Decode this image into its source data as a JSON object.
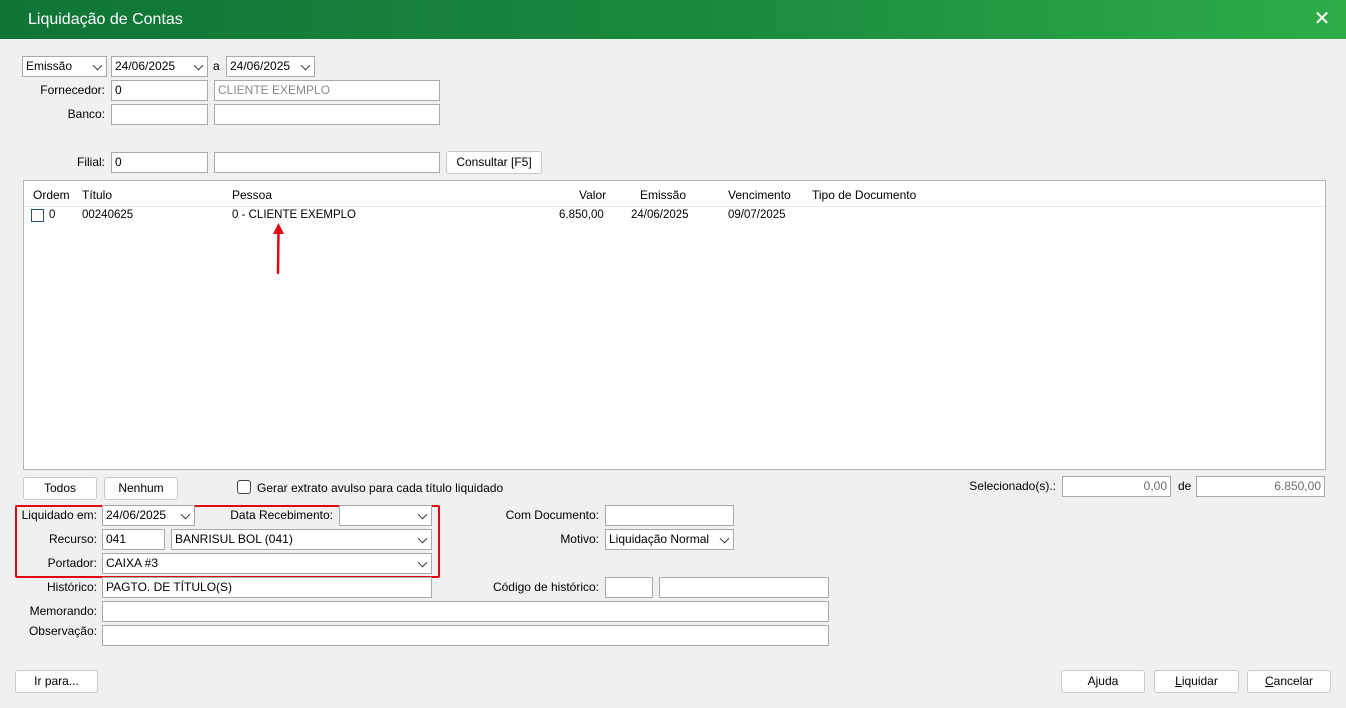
{
  "window": {
    "title": "Liquidação de Contas"
  },
  "filters": {
    "date_type": "Emissão",
    "date_from": "24/06/2025",
    "separator": "a",
    "date_to": "24/06/2025",
    "fornecedor_label": "Fornecedor:",
    "fornecedor_code": "0",
    "fornecedor_name": "CLIENTE EXEMPLO",
    "banco_label": "Banco:",
    "banco_code": "",
    "banco_name": "",
    "filial_label": "Filial:",
    "filial_code": "0",
    "filial_name": "",
    "consultar_label": "Consultar [F5]"
  },
  "grid": {
    "columns": [
      "Ordem",
      "Título",
      "Pessoa",
      "Valor",
      "Emissão",
      "Vencimento",
      "Tipo de Documento"
    ],
    "rows": [
      {
        "checked": false,
        "ordem": "0",
        "titulo": "00240625",
        "pessoa": "0 - CLIENTE EXEMPLO",
        "valor": "6.850,00",
        "emissao": "24/06/2025",
        "vencimento": "09/07/2025",
        "tipo": ""
      }
    ]
  },
  "selection": {
    "todos_label": "Todos",
    "nenhum_label": "Nenhum",
    "extrato_label": "Gerar extrato avulso para cada título liquidado",
    "extrato_checked": false,
    "selecionados_label": "Selecionado(s).:",
    "selecionados_value": "0,00",
    "de_label": "de",
    "total_value": "6.850,00"
  },
  "form": {
    "liquidado_label": "Liquidado em:",
    "liquidado_value": "24/06/2025",
    "data_receb_label": "Data Recebimento:",
    "data_receb_value": "",
    "recurso_label": "Recurso:",
    "recurso_code": "041",
    "recurso_name": "BANRISUL BOL (041)",
    "portador_label": "Portador:",
    "portador_value": "CAIXA #3",
    "historico_label": "Histórico:",
    "historico_value": "PAGTO. DE TÍTULO(S)",
    "memorando_label": "Memorando:",
    "memorando_value": "",
    "observacao_label": "Observação:",
    "observacao_value": "",
    "com_documento_label": "Com Documento:",
    "com_documento_value": "",
    "motivo_label": "Motivo:",
    "motivo_value": "Liquidação Normal",
    "codigo_hist_label": "Código de histórico:",
    "codigo_hist_code": "",
    "codigo_hist_desc": ""
  },
  "footer": {
    "ir_para_label": "Ir para...",
    "ajuda_label": "Ajuda",
    "liquidar_first": "L",
    "liquidar_rest": "iquidar",
    "cancelar_first": "C",
    "cancelar_rest": "ancelar"
  },
  "colors": {
    "title_gradient_start": "#0f7436",
    "title_gradient_end": "#2fac48",
    "highlight": "#e30613"
  }
}
